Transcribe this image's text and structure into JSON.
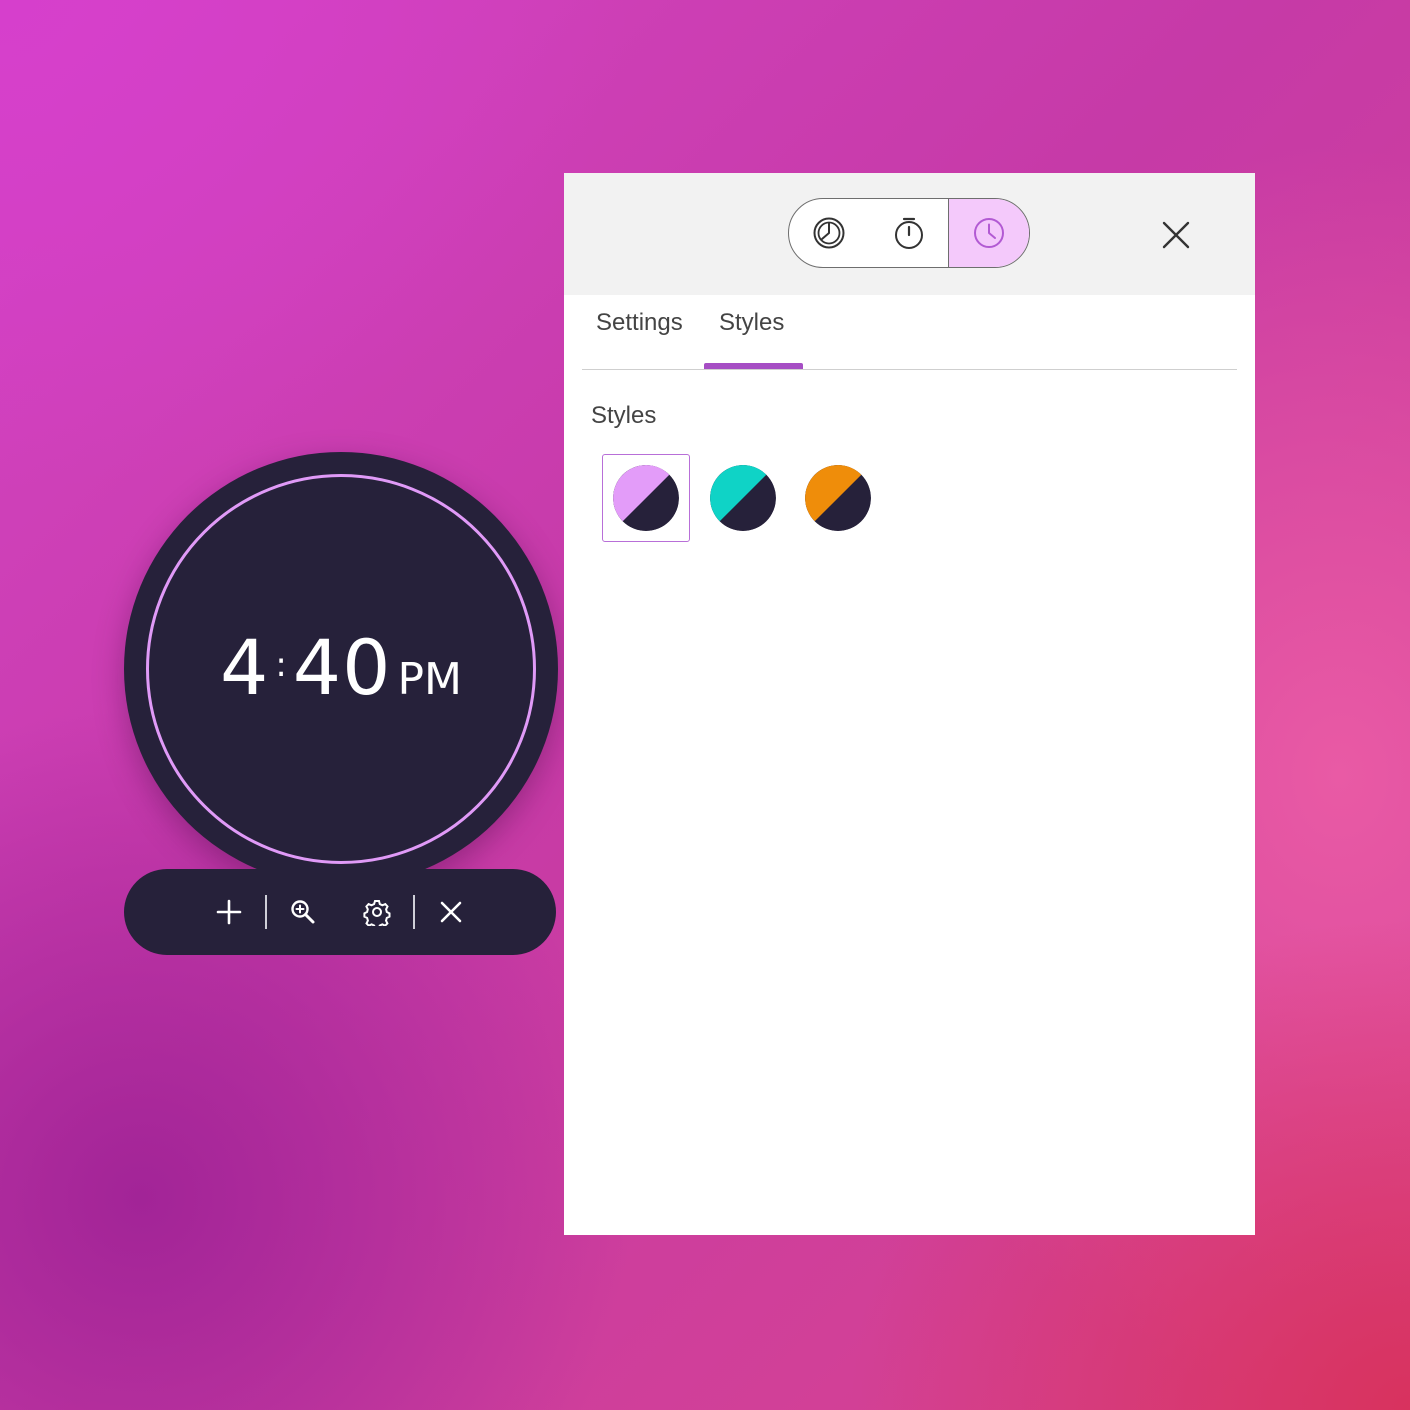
{
  "clock": {
    "hour": "4",
    "separator": ":",
    "minutes": "40",
    "ampm": "PM",
    "ring_color": "#e09af7",
    "face_color": "#26213a"
  },
  "clock_toolbar": {
    "add_icon": "plus-icon",
    "zoom_icon": "zoom-in-icon",
    "settings_icon": "gear-icon",
    "close_icon": "close-icon"
  },
  "panel": {
    "mode_switch": [
      {
        "icon": "clock-face-icon",
        "active": false
      },
      {
        "icon": "stopwatch-icon",
        "active": false
      },
      {
        "icon": "clock-icon",
        "active": true
      }
    ],
    "close_icon": "close-icon",
    "tabs": [
      {
        "label": "Settings",
        "active": false
      },
      {
        "label": "Styles",
        "active": true
      }
    ],
    "styles_section": {
      "title": "Styles",
      "options": [
        {
          "accent": "#e39cf9",
          "dark": "#26213a",
          "selected": true
        },
        {
          "accent": "#0fd3c6",
          "dark": "#26213a",
          "selected": false
        },
        {
          "accent": "#ef8d0a",
          "dark": "#26213a",
          "selected": false
        }
      ]
    },
    "accent_color": "#a64ec4"
  }
}
